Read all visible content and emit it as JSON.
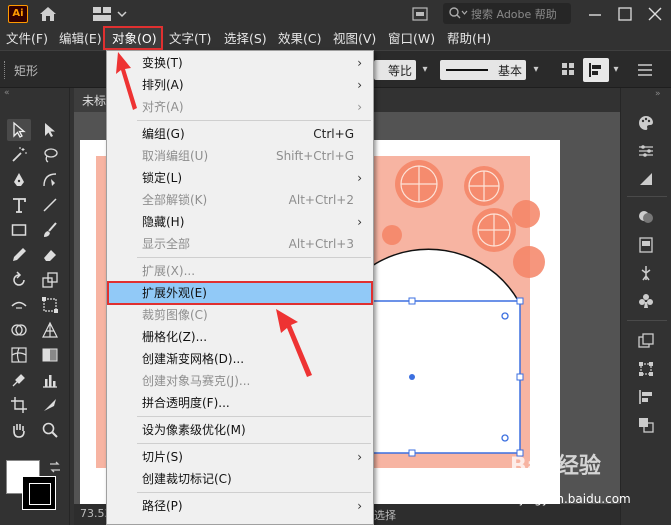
{
  "titlebar": {
    "app_logo": "Ai",
    "search_placeholder": "搜索 Adobe 帮助",
    "icons": [
      "home-icon",
      "workspace-switcher-icon",
      "document-icon",
      "search-icon",
      "minimize-icon",
      "maximize-icon",
      "close-icon"
    ]
  },
  "menubar": {
    "items": [
      {
        "label": "文件(F)"
      },
      {
        "label": "编辑(E)"
      },
      {
        "label": "对象(O)"
      },
      {
        "label": "文字(T)"
      },
      {
        "label": "选择(S)"
      },
      {
        "label": "效果(C)"
      },
      {
        "label": "视图(V)"
      },
      {
        "label": "窗口(W)"
      },
      {
        "label": "帮助(H)"
      }
    ],
    "active": "对象(O)"
  },
  "controlbar": {
    "shape_label": "矩形",
    "stroke_profile": "等比",
    "brush": "基本"
  },
  "document": {
    "tab_title": "未标",
    "zoom": "73.53",
    "status_mode": "选择"
  },
  "object_menu": {
    "items": [
      {
        "label": "变换(T)",
        "shortcut": "",
        "submenu": true,
        "disabled": false
      },
      {
        "label": "排列(A)",
        "shortcut": "",
        "submenu": true,
        "disabled": false
      },
      {
        "label": "对齐(A)",
        "shortcut": "",
        "submenu": true,
        "disabled": true
      },
      {
        "sep": true
      },
      {
        "label": "编组(G)",
        "shortcut": "Ctrl+G",
        "submenu": false,
        "disabled": false
      },
      {
        "label": "取消编组(U)",
        "shortcut": "Shift+Ctrl+G",
        "submenu": false,
        "disabled": true
      },
      {
        "label": "锁定(L)",
        "shortcut": "",
        "submenu": true,
        "disabled": false
      },
      {
        "label": "全部解锁(K)",
        "shortcut": "Alt+Ctrl+2",
        "submenu": false,
        "disabled": true
      },
      {
        "label": "隐藏(H)",
        "shortcut": "",
        "submenu": true,
        "disabled": false
      },
      {
        "label": "显示全部",
        "shortcut": "Alt+Ctrl+3",
        "submenu": false,
        "disabled": true
      },
      {
        "sep": true
      },
      {
        "label": "扩展(X)...",
        "shortcut": "",
        "submenu": false,
        "disabled": true
      },
      {
        "label": "扩展外观(E)",
        "shortcut": "",
        "submenu": false,
        "disabled": false,
        "highlighted": true
      },
      {
        "label": "裁剪图像(C)",
        "shortcut": "",
        "submenu": false,
        "disabled": true
      },
      {
        "label": "栅格化(Z)...",
        "shortcut": "",
        "submenu": false,
        "disabled": false
      },
      {
        "label": "创建渐变网格(D)...",
        "shortcut": "",
        "submenu": false,
        "disabled": false
      },
      {
        "label": "创建对象马赛克(J)...",
        "shortcut": "",
        "submenu": false,
        "disabled": true
      },
      {
        "label": "拼合透明度(F)...",
        "shortcut": "",
        "submenu": false,
        "disabled": false
      },
      {
        "sep": true
      },
      {
        "label": "设为像素级优化(M)",
        "shortcut": "",
        "submenu": false,
        "disabled": false
      },
      {
        "sep": true
      },
      {
        "label": "切片(S)",
        "shortcut": "",
        "submenu": true,
        "disabled": false
      },
      {
        "label": "创建裁切标记(C)",
        "shortcut": "",
        "submenu": false,
        "disabled": false
      },
      {
        "sep": true
      },
      {
        "label": "路径(P)",
        "shortcut": "",
        "submenu": true,
        "disabled": false
      }
    ]
  },
  "watermark": {
    "brand": "Bai 经验",
    "url": "jingyan.baidu.com"
  },
  "colors": {
    "ui_bg": "#323232",
    "menu_bg": "#f0f0f0",
    "highlight": "#91c9f7",
    "annotation_red": "#e03030",
    "pattern_bg": "#f7b4a2",
    "selection_blue": "#3b6fe0"
  }
}
